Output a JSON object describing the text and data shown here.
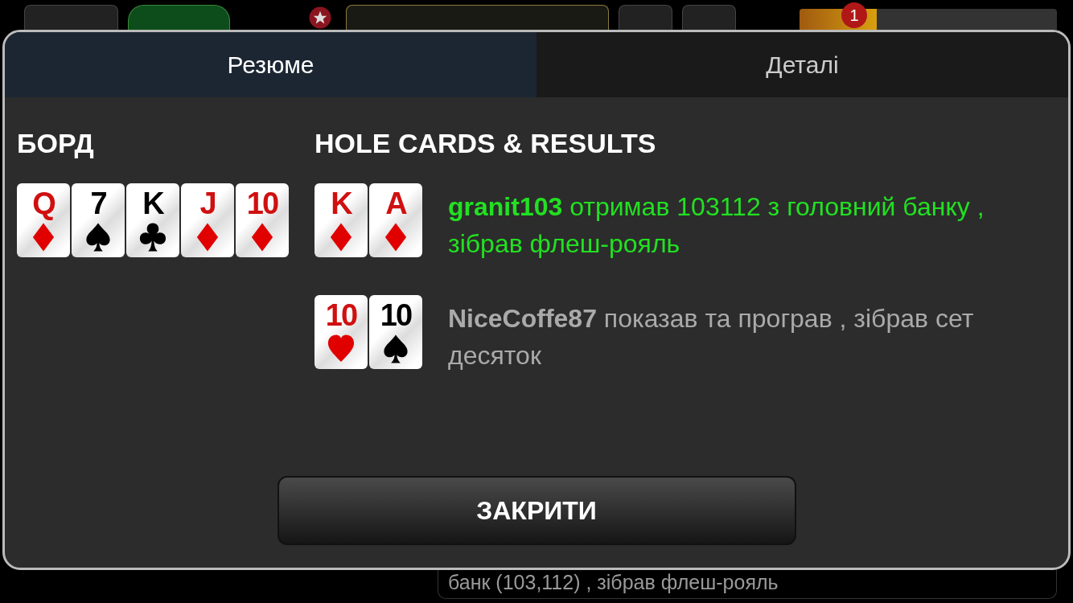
{
  "background": {
    "notification_count": "1",
    "progress": {
      "level": 0.3
    },
    "last_action": "банк  (103,112) , зібрав флеш-рояль"
  },
  "tabs": [
    {
      "label": "Резюме",
      "selected": true
    },
    {
      "label": "Деталі",
      "selected": false
    }
  ],
  "board": {
    "title": "БОРД",
    "cards": [
      {
        "rank": "Q",
        "kind": "diamonds"
      },
      {
        "rank": "7",
        "kind": "spades"
      },
      {
        "rank": "K",
        "kind": "clubs"
      },
      {
        "rank": "J",
        "kind": "diamonds"
      },
      {
        "rank": "10",
        "kind": "diamonds"
      }
    ]
  },
  "results": {
    "title": "HOLE CARDS & RESULTS",
    "players": [
      {
        "name": "granit103",
        "text": "отримав 103112 з головний банку , зібрав флеш-рояль",
        "winner": true,
        "cards": [
          {
            "rank": "K",
            "kind": "diamonds"
          },
          {
            "rank": "A",
            "kind": "diamonds"
          }
        ]
      },
      {
        "name": "NiceCoffe87",
        "text": "показав та програв , зібрав сет десяток",
        "winner": false,
        "cards": [
          {
            "rank": "10",
            "kind": "hearts"
          },
          {
            "rank": "10",
            "kind": "spades"
          }
        ]
      }
    ]
  },
  "close_button": "ЗАКРИТИ"
}
